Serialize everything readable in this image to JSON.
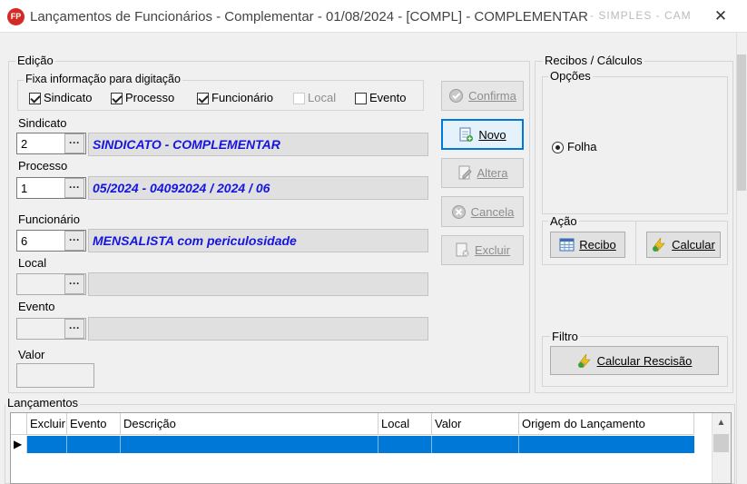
{
  "window": {
    "app_icon": "FP",
    "title": "Lançamentos de Funcionários - Complementar -  01/08/2024 - [COMPL] - COMPLEMENTAR",
    "title_obscured": "- SIMPLES - CAM..."
  },
  "edicao": {
    "group_label": "Edição",
    "fixa_label": "Fixa informação para digitação",
    "checks": [
      {
        "label": "Sindicato",
        "checked": true,
        "enabled": true
      },
      {
        "label": "Processo",
        "checked": true,
        "enabled": true
      },
      {
        "label": "Funcionário",
        "checked": true,
        "enabled": true
      },
      {
        "label": "Local",
        "checked": false,
        "enabled": false
      },
      {
        "label": "Evento",
        "checked": false,
        "enabled": true
      }
    ],
    "sindicato": {
      "label": "Sindicato",
      "value": "2",
      "desc": "SINDICATO - COMPLEMENTAR"
    },
    "processo": {
      "label": "Processo",
      "value": "1",
      "desc": "05/2024 - 04092024 / 2024 / 06"
    },
    "funcionario": {
      "label": "Funcionário",
      "value": "6",
      "desc": "MENSALISTA com periculosidade"
    },
    "local": {
      "label": "Local",
      "value": "",
      "desc": ""
    },
    "evento": {
      "label": "Evento",
      "value": "",
      "desc": ""
    },
    "valor": {
      "label": "Valor",
      "value": ""
    },
    "dots_glyph": "···"
  },
  "buttons": {
    "confirma": "Confirma",
    "novo": "Novo",
    "altera": "Altera",
    "cancela": "Cancela",
    "excluir": "Excluir"
  },
  "recibos": {
    "group_label": "Recibos / Cálculos",
    "opcoes_label": "Opções",
    "folha_label": "Folha",
    "acao_label": "Ação",
    "recibo_button": "Recibo",
    "calcular_button": "Calcular",
    "filtro_label": "Filtro",
    "rescisao_button": "Calcular Rescisão"
  },
  "lancamentos": {
    "group_label": "Lançamentos",
    "columns": [
      "Excluir",
      "Evento",
      "Descrição",
      "Local",
      "Valor",
      "Origem do Lançamento"
    ],
    "row_indicator": "▶",
    "scroll_up": "▲"
  },
  "colors": {
    "accent": "#0078d7",
    "desc_text": "#1515e0",
    "app_icon": "#d42a26"
  }
}
